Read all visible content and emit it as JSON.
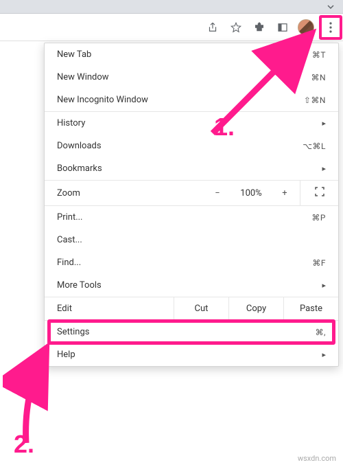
{
  "annotations": {
    "one": "1.",
    "two": "2.",
    "watermark": "wsxdn.com",
    "color": "#ff1b8d"
  },
  "menu": {
    "new_tab": {
      "label": "New Tab",
      "shortcut": "⌘T"
    },
    "new_window": {
      "label": "New Window",
      "shortcut": "⌘N"
    },
    "new_incognito": {
      "label": "New Incognito Window",
      "shortcut": "⇧⌘N"
    },
    "history": {
      "label": "History",
      "arrow": "▸"
    },
    "downloads": {
      "label": "Downloads",
      "shortcut": "⌥⌘L"
    },
    "bookmarks": {
      "label": "Bookmarks",
      "arrow": "▸"
    },
    "zoom": {
      "label": "Zoom",
      "minus": "−",
      "value": "100%",
      "plus": "+"
    },
    "print": {
      "label": "Print...",
      "shortcut": "⌘P"
    },
    "cast": {
      "label": "Cast..."
    },
    "find": {
      "label": "Find...",
      "shortcut": "⌘F"
    },
    "more_tools": {
      "label": "More Tools",
      "arrow": "▸"
    },
    "edit": {
      "label": "Edit",
      "cut": "Cut",
      "copy": "Copy",
      "paste": "Paste"
    },
    "settings": {
      "label": "Settings",
      "shortcut": "⌘,"
    },
    "help": {
      "label": "Help",
      "arrow": "▸"
    }
  }
}
